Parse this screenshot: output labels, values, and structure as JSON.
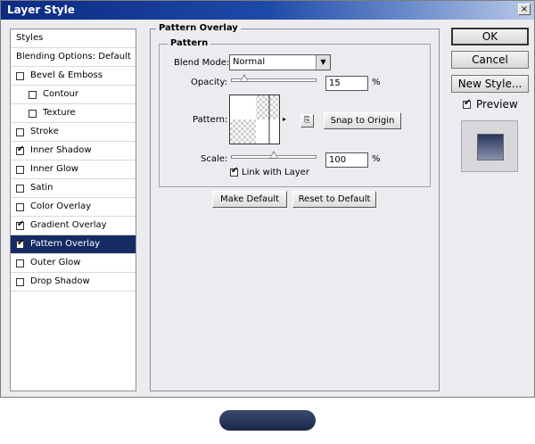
{
  "window": {
    "title": "Layer Style",
    "close_glyph": "×"
  },
  "styles_panel": {
    "header": "Styles",
    "blending": "Blending Options: Default",
    "items": [
      {
        "label": "Bevel & Emboss",
        "checked": false
      },
      {
        "label": "Contour",
        "checked": false
      },
      {
        "label": "Texture",
        "checked": false
      },
      {
        "label": "Stroke",
        "checked": false
      },
      {
        "label": "Inner Shadow",
        "checked": true
      },
      {
        "label": "Inner Glow",
        "checked": false
      },
      {
        "label": "Satin",
        "checked": false
      },
      {
        "label": "Color Overlay",
        "checked": false
      },
      {
        "label": "Gradient Overlay",
        "checked": true
      },
      {
        "label": "Pattern Overlay",
        "checked": true,
        "selected": true
      },
      {
        "label": "Outer Glow",
        "checked": false
      },
      {
        "label": "Drop Shadow",
        "checked": false
      }
    ]
  },
  "pattern_overlay": {
    "group_title": "Pattern Overlay",
    "subgroup_title": "Pattern",
    "blend_mode_label": "Blend Mode:",
    "blend_mode_value": "Normal",
    "opacity_label": "Opacity:",
    "opacity_value": "15",
    "opacity_percent": 15,
    "pattern_label": "Pattern:",
    "snap_button": "Snap to Origin",
    "scale_label": "Scale:",
    "scale_value": "100",
    "scale_percent": 100,
    "link_label": "Link with Layer",
    "link_checked": true,
    "unit": "%"
  },
  "actions": {
    "make_default": "Make Default",
    "reset_default": "Reset to Default"
  },
  "right": {
    "ok": "OK",
    "cancel": "Cancel",
    "new_style": "New Style...",
    "preview_label": "Preview",
    "preview_checked": true
  }
}
